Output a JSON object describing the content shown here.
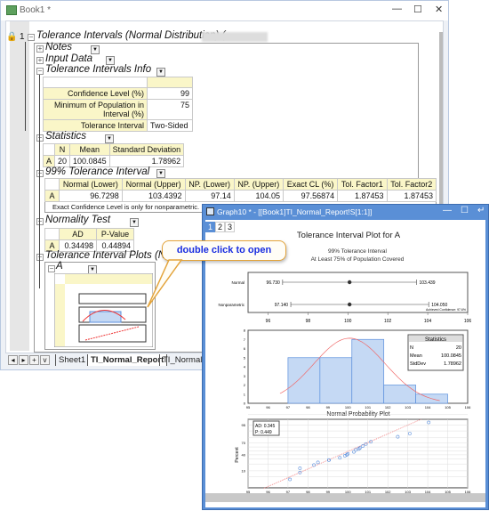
{
  "book": {
    "title": "Book1 *",
    "window_controls": {
      "minimize": "—",
      "maximize": "☐",
      "close": "✕"
    },
    "report": {
      "row_number": "1",
      "title": "Tolerance Intervals (Normal Distribution) (",
      "sections": {
        "notes": "Notes",
        "input_data": "Input Data",
        "info": "Tolerance Intervals Info",
        "statistics": "Statistics",
        "interval": "99% Tolerance Interval",
        "normality": "Normality Test",
        "plots": "Tolerance Interval Plots (Nor",
        "plots_sub": "A"
      },
      "info_table": [
        {
          "label": "Confidence Level (%)",
          "value": "99"
        },
        {
          "label": "Minimum of Population in Interval (%)",
          "value": "75"
        },
        {
          "label": "Tolerance Interval",
          "value": "Two-Sided"
        }
      ],
      "stats_table": {
        "headers": [
          "N",
          "Mean",
          "Standard Deviation"
        ],
        "row_label": "A",
        "values": [
          "20",
          "100.0845",
          "1.78962"
        ]
      },
      "interval_table": {
        "headers": [
          "Normal (Lower)",
          "Normal (Upper)",
          "NP. (Lower)",
          "NP. (Upper)",
          "Exact CL (%)",
          "Tol. Factor1",
          "Tol. Factor2"
        ],
        "row_label": "A",
        "values": [
          "96.7298",
          "103.4392",
          "97.14",
          "104.05",
          "97.56874",
          "1.87453",
          "1.87453"
        ],
        "note": "Exact Confidence Level is only for nonparametric."
      },
      "normality_table": {
        "headers": [
          "AD",
          "P-Value"
        ],
        "row_label": "A",
        "values": [
          "0.34498",
          "0.44894"
        ]
      }
    },
    "sheet_tabs": [
      "Sheet1",
      "TI_Normal_Report",
      "TI_Normal_"
    ],
    "active_tab": "TI_Normal_Report",
    "nav_buttons": [
      "◂",
      "▸",
      "+",
      "v"
    ]
  },
  "callout": "double click to open",
  "graph": {
    "title": "Graph10 * - [[Book1]TI_Normal_Report!S[1:1]]",
    "pages": [
      "1",
      "2",
      "3"
    ],
    "active_page": "1",
    "window_controls": {
      "minimize": "—",
      "maximize": "☐",
      "restore": "↵"
    },
    "plot_title": "Tolerance Interval Plot for A",
    "subtitle1": "99% Tolerance Interval",
    "subtitle2": "At Least 75% of Population Covered",
    "stats_box": {
      "title": "Statistics",
      "rows": [
        [
          "N",
          "20"
        ],
        [
          "Mean",
          "100.0845"
        ],
        [
          "StdDev",
          "1.78962"
        ]
      ]
    },
    "ad_box": [
      "AD: 0.345",
      "P: 0.449"
    ],
    "prob_title": "Normal Probability Plot",
    "prob_ylabel": "Percent"
  },
  "chart_data": [
    {
      "type": "scatter",
      "name": "interval-plot",
      "xlim": [
        95,
        106
      ],
      "x_ticks": [
        96,
        98,
        100,
        102,
        104,
        106
      ],
      "rows": [
        {
          "label": "Normal",
          "lower": 96.73,
          "center": 100.0845,
          "upper": 103.439,
          "lower_label": "96.730",
          "upper_label": "103.439"
        },
        {
          "label": "Nonparametric",
          "lower": 97.14,
          "center": 100.0845,
          "upper": 104.05,
          "lower_label": "97.140",
          "upper_label": "104.050"
        }
      ],
      "annotation": "Achieved Confidence: 97.6%"
    },
    {
      "type": "bar",
      "name": "histogram",
      "xlim": [
        95,
        106
      ],
      "ylim": [
        0,
        8
      ],
      "x_ticks": [
        95,
        96,
        97,
        98,
        99,
        100,
        101,
        102,
        103,
        104,
        105,
        106
      ],
      "y_ticks": [
        0,
        1,
        2,
        3,
        4,
        5,
        6,
        7,
        8
      ],
      "bins": [
        [
          97,
          98.6
        ],
        [
          98.6,
          100.2
        ],
        [
          100.2,
          101.8
        ],
        [
          101.8,
          103.4
        ],
        [
          103.4,
          105
        ]
      ],
      "counts": [
        5,
        5,
        7,
        2,
        1
      ],
      "fit": {
        "mean": 100.0845,
        "sd": 1.78962,
        "n": 20
      },
      "colors": {
        "bar": "#c5d9f4",
        "bar_edge": "#5b8fdc",
        "curve": "#f06a6a"
      }
    },
    {
      "type": "scatter",
      "name": "normal-probability",
      "title": "Normal Probability Plot",
      "ylabel": "Percent",
      "xlim": [
        95,
        106
      ],
      "x_ticks": [
        95,
        96,
        97,
        98,
        99,
        100,
        101,
        102,
        103,
        104,
        105,
        106
      ],
      "y_ticks": [
        10,
        40,
        70,
        95
      ],
      "x": [
        97.1,
        97.6,
        97.6,
        98.3,
        98.5,
        99.05,
        99.05,
        99.6,
        99.85,
        99.95,
        100.0,
        100.3,
        100.4,
        100.55,
        100.6,
        100.75,
        100.9,
        101.15,
        102.5,
        103.1,
        104.05
      ],
      "percent": [
        3.4,
        8.3,
        13.2,
        18.1,
        23.0,
        27.9,
        27.9,
        32.8,
        37.7,
        40.0,
        42.6,
        47.5,
        52.5,
        55.0,
        57.4,
        62.3,
        67.2,
        72.1,
        81.9,
        86.8,
        96.6
      ]
    }
  ]
}
